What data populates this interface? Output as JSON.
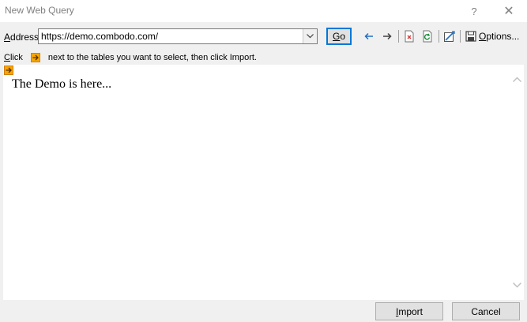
{
  "window": {
    "title": "New Web Query",
    "help_glyph": "?",
    "close_glyph": "✕"
  },
  "address_bar": {
    "label_mnemonic": "A",
    "label_rest": "ddress:",
    "url_value": "https://demo.combodo.com/",
    "go_mnemonic": "G",
    "go_rest": "o"
  },
  "toolbar": {
    "icons": [
      "back-arrow-icon",
      "forward-arrow-icon",
      "stop-icon",
      "refresh-icon",
      "save-query-icon",
      "options-icon"
    ],
    "options_mnemonic": "O",
    "options_rest": "ptions..."
  },
  "instruction": {
    "prefix_mnemonic": "C",
    "prefix_rest": "lick",
    "suffix": "next to the tables you want to select, then click Import."
  },
  "content": {
    "page_text": "The Demo is here..."
  },
  "footer": {
    "import_mnemonic": "I",
    "import_rest": "mport",
    "cancel_label": "Cancel"
  },
  "colors": {
    "accent": "#0078d7",
    "arrow_badge": "#f7a600",
    "back_arrow": "#1f6fc5"
  }
}
